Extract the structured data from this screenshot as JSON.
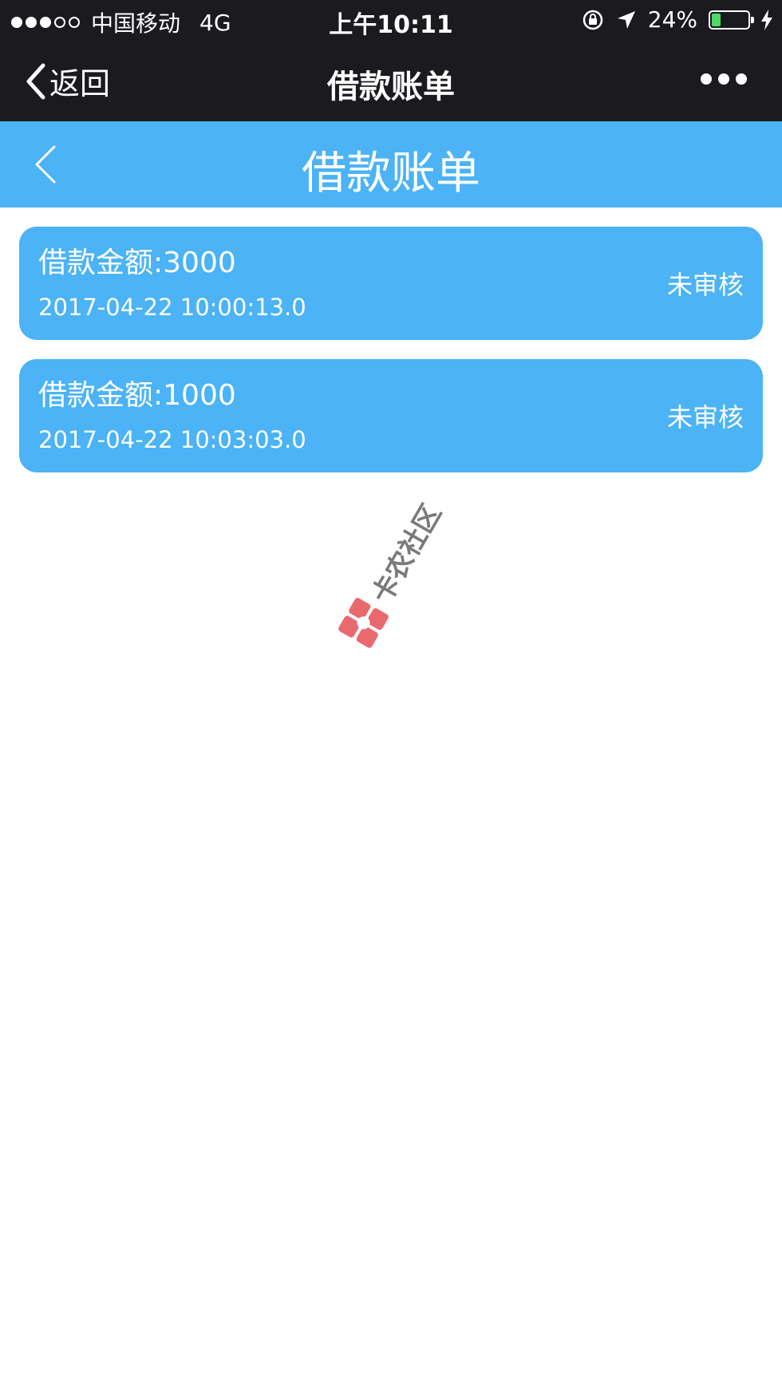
{
  "status_bar": {
    "carrier": "中国移动",
    "network": "4G",
    "time": "上午10:11",
    "battery_percent": "24%",
    "battery_level": 0.24,
    "signal_bars_filled": 3,
    "signal_bars_total": 5
  },
  "wechat_nav": {
    "back_label": "返回",
    "title": "借款账单"
  },
  "page_header": {
    "title": "借款账单"
  },
  "loans": [
    {
      "amount": "借款金额:3000",
      "time": "2017-04-22 10:00:13.0",
      "status": "未审核"
    },
    {
      "amount": "借款金额:1000",
      "time": "2017-04-22 10:03:03.0",
      "status": "未审核"
    }
  ],
  "watermark": {
    "text": "卡农社区"
  },
  "colors": {
    "accent_blue": "#4bb3f6",
    "nav_dark": "#1b1b1f",
    "battery_green": "#4cd964",
    "watermark_logo": "#e86a6f"
  }
}
